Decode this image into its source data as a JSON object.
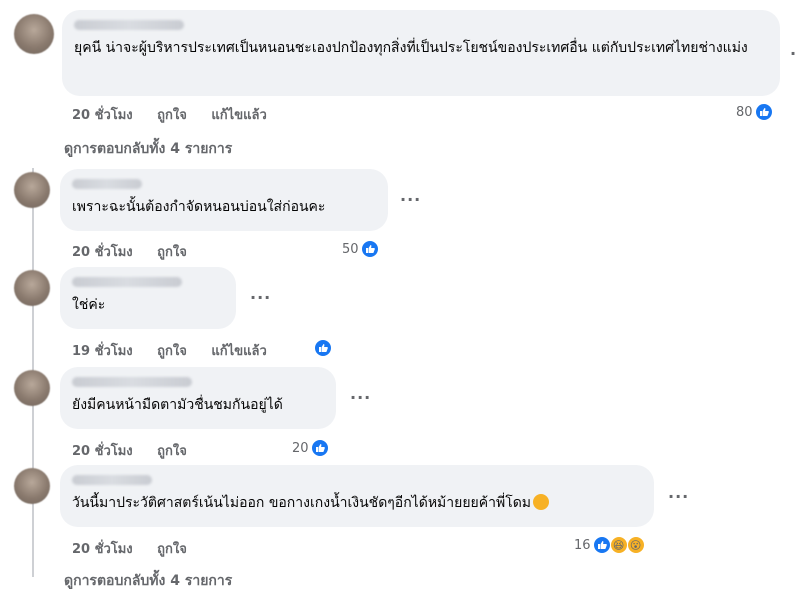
{
  "colors": {
    "accent": "#1877f2",
    "bubble": "#f0f2f5",
    "muted": "#65676b"
  },
  "comments": [
    {
      "text": "ยุคนี น่าจะผู้บริหารประเทศเป็นหนอนชะเองปกป้องทุกสิ่งที่เป็นประโยชน์ของประเทศอื่น แต่กับประเทศไทยช่างแม่ง",
      "time": "20 ชั่วโมง",
      "like": "ถูกใจ",
      "edited": "แก้ไขแล้ว",
      "reaction_count": "80",
      "view_replies": "ดูการตอบกลับทั้ง 4 รายการ"
    },
    {
      "text": "เพราะฉะนั้นต้องกำจัดหนอนบ่อนใส่ก่อนคะ",
      "time": "20 ชั่วโมง",
      "like": "ถูกใจ",
      "reaction_count": "50"
    },
    {
      "text": "ใช่ค่ะ",
      "time": "19 ชั่วโมง",
      "like": "ถูกใจ",
      "edited": "แก้ไขแล้ว"
    },
    {
      "text": "ยังมีคนหน้ามืดตามัวชื่นชมกันอยู่ได้",
      "time": "20 ชั่วโมง",
      "like": "ถูกใจ",
      "reaction_count": "20"
    },
    {
      "text": "วันนี้มาประวัติศาสตร์เน้นไม่ออก ขอกางเกงน้ำเงินชัดๆอีกได้หม้ายยยค้าพี่โดม",
      "time": "20 ชั่วโมง",
      "like": "ถูกใจ",
      "reaction_count": "16",
      "view_replies": "ดูการตอบกลับทั้ง 4 รายการ"
    }
  ],
  "more": "···",
  "icons": {
    "like": "like-icon",
    "haha": "haha-icon",
    "wow": "wow-icon",
    "emoji": "laughing-tears-emoji"
  }
}
